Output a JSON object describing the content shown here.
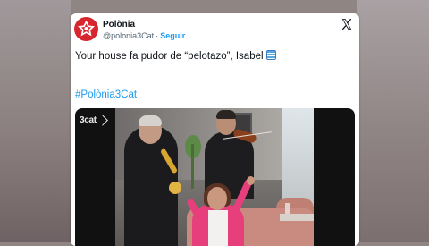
{
  "tweet": {
    "display_name": "Polònia",
    "handle": "@polonia3Cat",
    "separator": "·",
    "follow_label": "Seguir",
    "text": "Your house fa pudor de “pelotazo”, Isabel",
    "text_emoji": "pencil-emoji",
    "hashtag": "#Polònia3Cat"
  },
  "media": {
    "broadcaster_logo": "3cat"
  },
  "icons": {
    "avatar": "polonia-logo-icon",
    "platform": "x-logo-icon"
  },
  "colors": {
    "link": "#1d9bf0",
    "avatar_bg": "#d7262e",
    "text": "#0f1419",
    "muted": "#536471"
  }
}
